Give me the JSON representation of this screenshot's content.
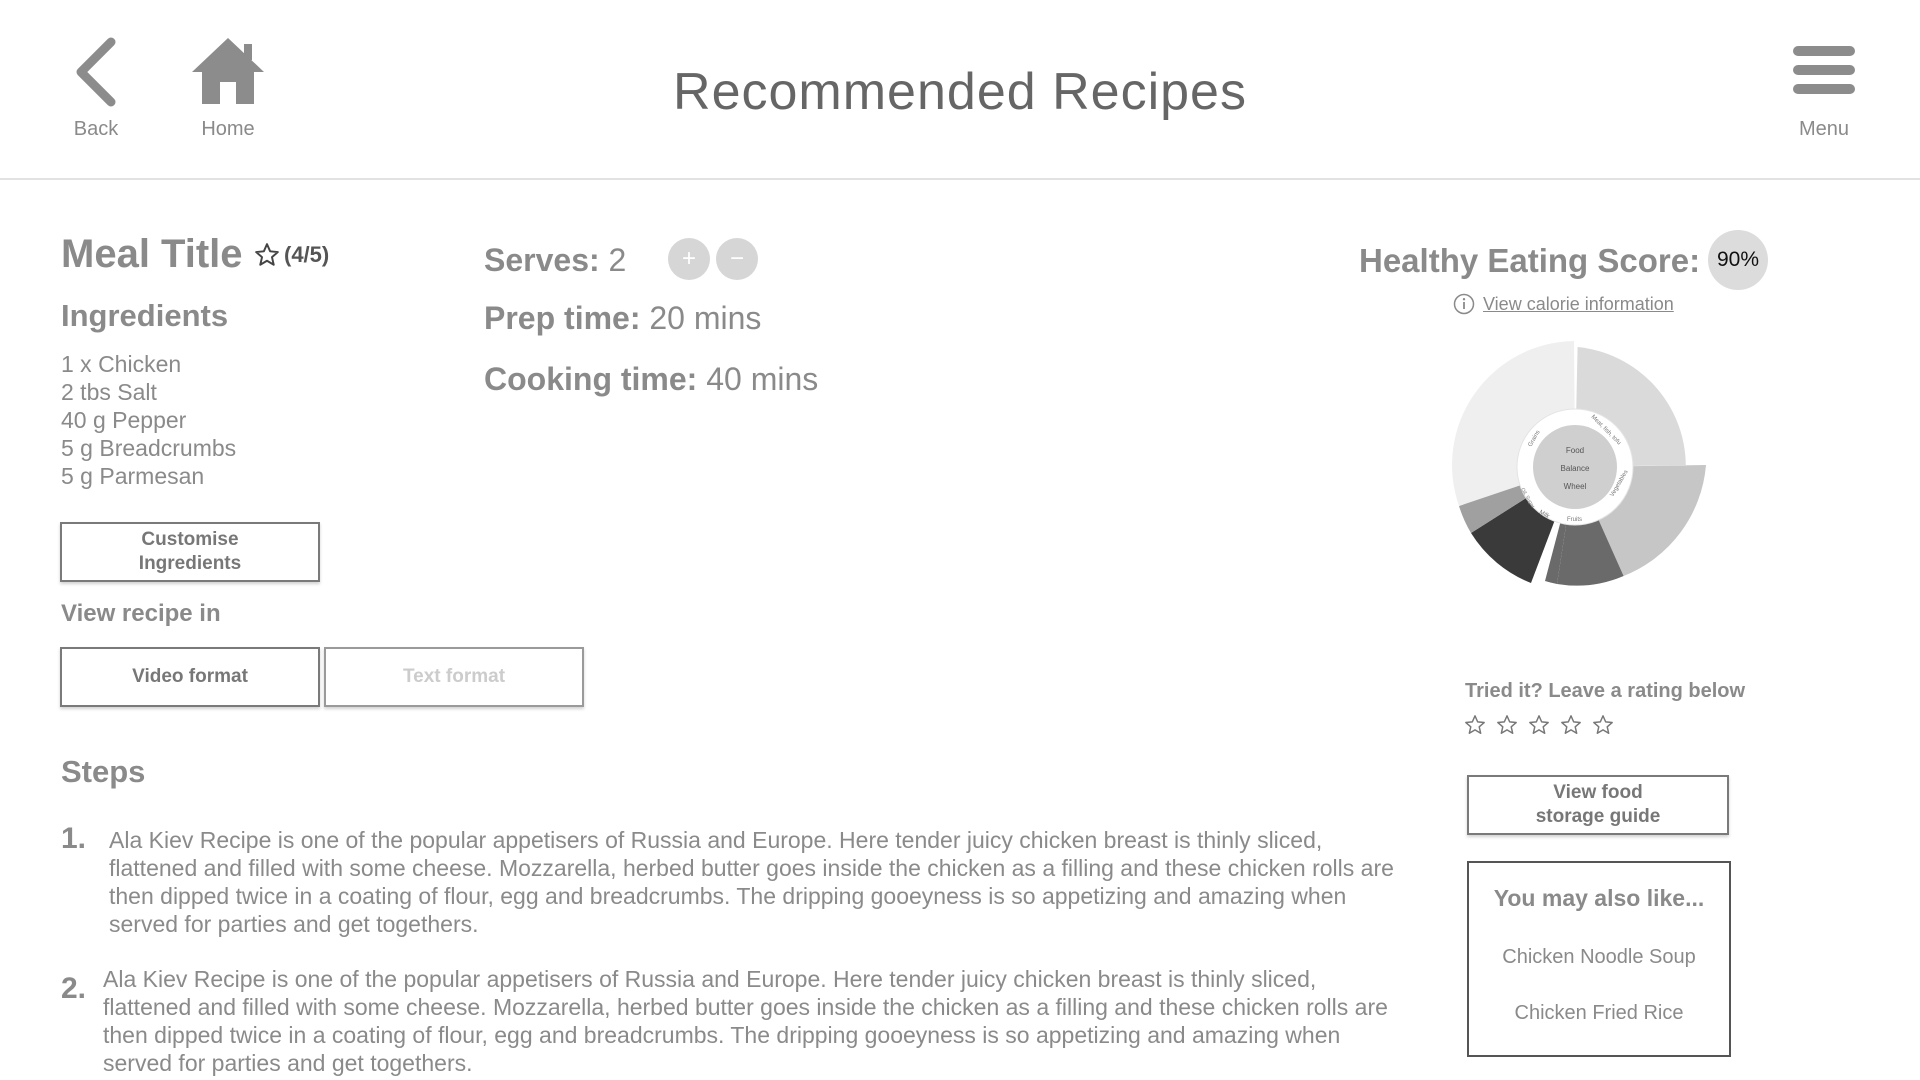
{
  "header": {
    "title": "Recommended Recipes",
    "back_label": "Back",
    "home_label": "Home",
    "menu_label": "Menu"
  },
  "meal": {
    "title": "Meal Title",
    "rating_text": "(4/5)",
    "ingredients_heading": "Ingredients",
    "ingredients": [
      "1 x Chicken",
      "2 tbs Salt",
      "40 g Pepper",
      "5 g Breadcrumbs",
      "5 g Parmesan"
    ],
    "customise_label_line1": "Customise",
    "customise_label_line2": "Ingredients",
    "view_recipe_label": "View recipe in",
    "video_format_label": "Video format",
    "text_format_label": "Text format"
  },
  "info": {
    "serves_label": "Serves:",
    "serves_value": "2",
    "plus_symbol": "+",
    "minus_symbol": "−",
    "prep_label": "Prep time:",
    "prep_value": "20 mins",
    "cook_label": "Cooking time:",
    "cook_value": "40 mins"
  },
  "steps": {
    "heading": "Steps",
    "items": [
      {
        "number": "1.",
        "text": "Ala Kiev Recipe is one of the popular appetisers of Russia and Europe. Here tender juicy chicken breast is thinly sliced, flattened and filled with some cheese. Mozzarella, herbed butter goes inside the chicken as a filling and these chicken rolls are then dipped twice in a coating of flour, egg and breadcrumbs. The dripping gooeyness is so appetizing and amazing when served for parties and get togethers."
      },
      {
        "number": "2.",
        "text": "Ala Kiev Recipe is one of the popular appetisers of Russia and Europe. Here tender juicy chicken breast is thinly sliced, flattened and filled with some cheese. Mozzarella, herbed butter goes inside the chicken as a filling and these chicken rolls are then dipped twice in a coating of flour, egg and breadcrumbs. The dripping gooeyness is so appetizing and amazing when served for parties and get togethers."
      }
    ]
  },
  "score": {
    "label": "Healthy Eating Score:",
    "value": "90%",
    "calorie_link": "View calorie information"
  },
  "wheel": {
    "center_lines": [
      "Food",
      "Balance",
      "Wheel"
    ],
    "segment_labels": [
      "Grains",
      "Meat, fish, tofu",
      "Vegetables",
      "Fruits",
      "Milk",
      "Oil, Sugar"
    ]
  },
  "rating": {
    "prompt": "Tried it? Leave a rating below",
    "max_stars": 5
  },
  "storage": {
    "label_line1": "View food",
    "label_line2": "storage guide"
  },
  "also_like": {
    "title": "You may also like...",
    "items": [
      "Chicken Noodle Soup",
      "Chicken Fried Rice"
    ]
  },
  "colors": {
    "text_gray": "#8a8a8a",
    "icon_gray": "#8c8c8c",
    "border_gray": "#7a7a7a",
    "badge_gray": "#dcdcdc"
  }
}
